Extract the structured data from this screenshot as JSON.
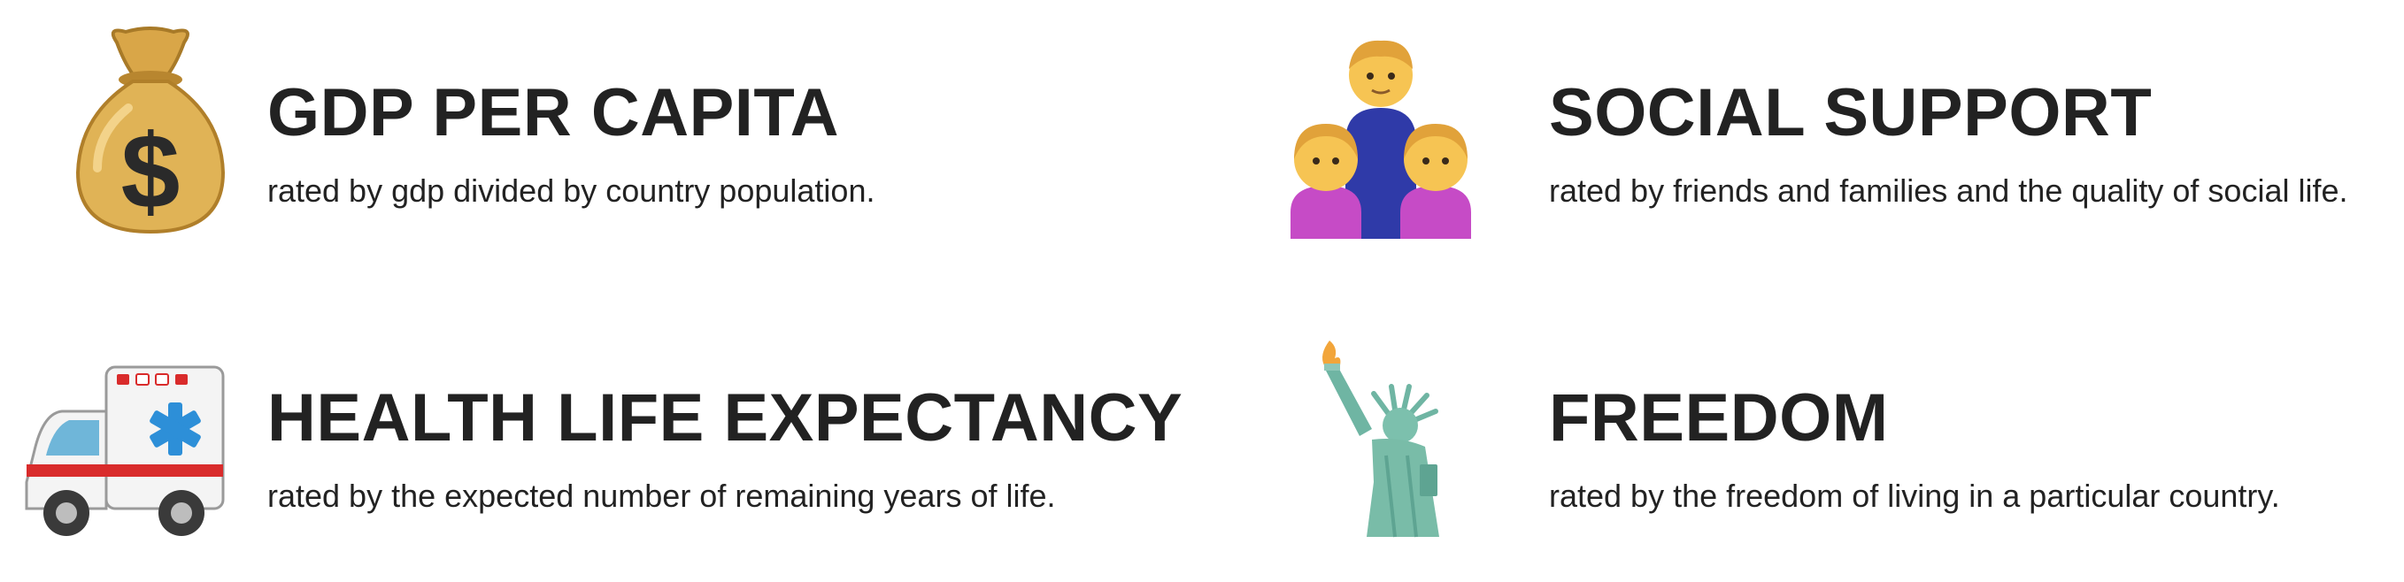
{
  "items": [
    {
      "icon": "money-bag-icon",
      "title": "GDP PER CAPITA",
      "description": "rated by gdp divided by country population."
    },
    {
      "icon": "family-icon",
      "title": "SOCIAL SUPPORT",
      "description": "rated by friends and families and the quality of social life."
    },
    {
      "icon": "ambulance-icon",
      "title": "HEALTH LIFE EXPECTANCY",
      "description": "rated by the expected number of remaining years of life."
    },
    {
      "icon": "statue-of-liberty-icon",
      "title": "FREEDOM",
      "description": "rated by the freedom of living in a particular country."
    }
  ],
  "colors": {
    "text": "#222222",
    "background": "#ffffff"
  }
}
